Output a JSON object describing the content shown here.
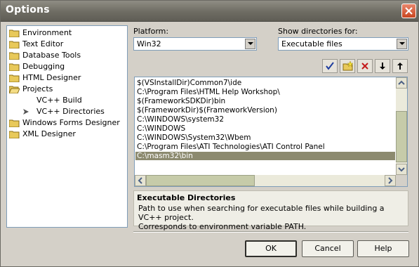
{
  "window": {
    "title": "Options"
  },
  "tree": {
    "items": [
      {
        "label": "Environment",
        "kind": "folder"
      },
      {
        "label": "Text Editor",
        "kind": "folder"
      },
      {
        "label": "Database Tools",
        "kind": "folder"
      },
      {
        "label": "Debugging",
        "kind": "folder"
      },
      {
        "label": "HTML Designer",
        "kind": "folder"
      },
      {
        "label": "Projects",
        "kind": "folder-open"
      },
      {
        "label": "VC++ Build",
        "kind": "child"
      },
      {
        "label": "VC++ Directories",
        "kind": "child-selected"
      },
      {
        "label": "Windows Forms Designer",
        "kind": "folder"
      },
      {
        "label": "XML Designer",
        "kind": "folder"
      }
    ]
  },
  "platform": {
    "label": "Platform:",
    "value": "Win32"
  },
  "show_dirs": {
    "label": "Show directories for:",
    "value": "Executable files"
  },
  "toolbar": {
    "icons": [
      "checkmark-icon",
      "new-folder-icon",
      "delete-icon",
      "move-down-icon",
      "move-up-icon"
    ]
  },
  "directories": {
    "rows": [
      "$(VSInstallDir)Common7\\ide",
      "C:\\Program Files\\HTML Help Workshop\\",
      "$(FrameworkSDKDir)bin",
      "$(FrameworkDir)$(FrameworkVersion)",
      "C:\\WINDOWS\\system32",
      "C:\\WINDOWS",
      "C:\\WINDOWS\\System32\\Wbem",
      "C:\\Program Files\\ATI Technologies\\ATI Control Panel",
      "C:\\masm32\\bin"
    ],
    "selected_index": 8
  },
  "description": {
    "title": "Executable Directories",
    "line1": "Path to use when searching for executable files while building a VC++ project.",
    "line2": "Corresponds to environment variable PATH."
  },
  "buttons": {
    "ok": "OK",
    "cancel": "Cancel",
    "help": "Help"
  },
  "colors": {
    "selection": "#8c8a6f",
    "titlebar": "#6e6c63",
    "close": "#c9451f"
  }
}
